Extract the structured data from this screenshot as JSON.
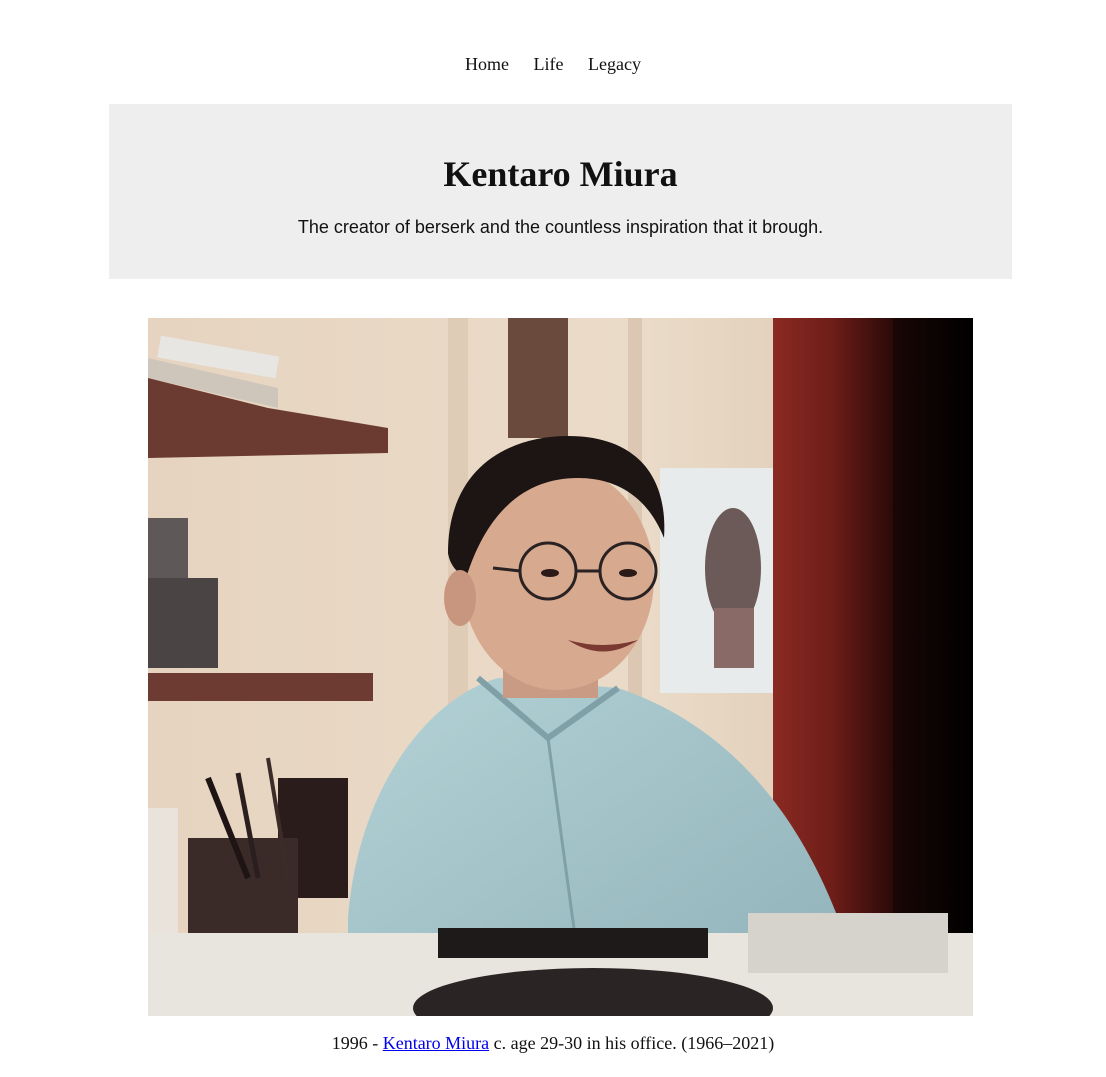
{
  "nav": {
    "items": [
      {
        "label": "Home"
      },
      {
        "label": "Life"
      },
      {
        "label": "Legacy"
      }
    ]
  },
  "header": {
    "title": "Kentaro Miura",
    "subtitle": "The creator of berserk and the countless inspiration that it brough."
  },
  "figure": {
    "caption": {
      "prefix": "1996 - ",
      "link": "Kentaro Miura",
      "suffix": " c. age 29-30 in his office. (1966–2021)"
    }
  },
  "colors": {
    "header_background": "#eeeeee",
    "link": "#0000ee"
  }
}
